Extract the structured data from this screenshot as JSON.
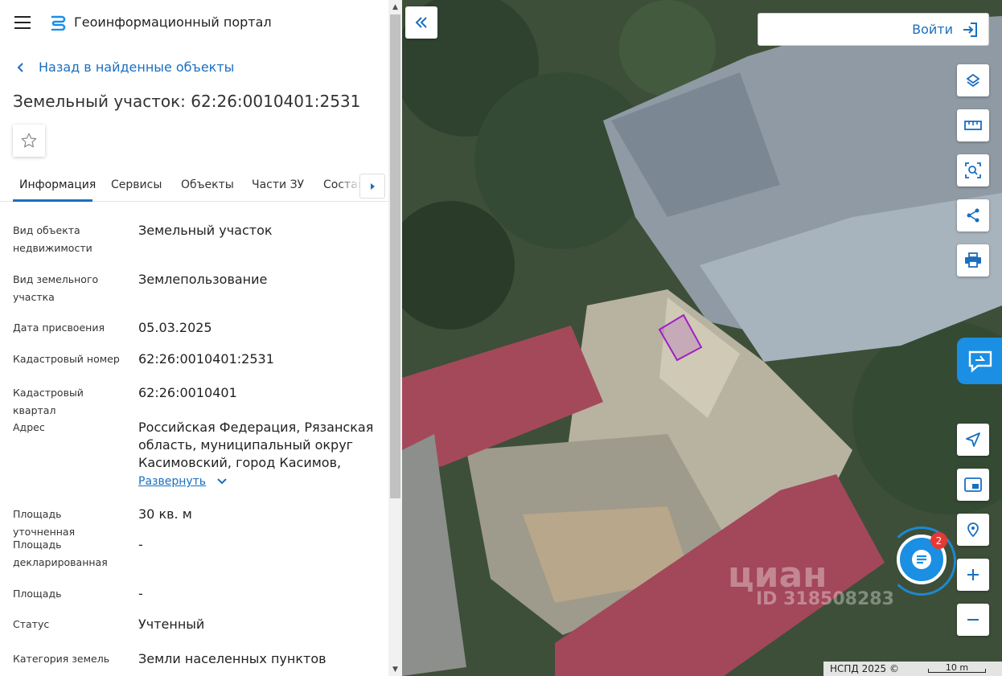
{
  "header": {
    "app_title": "Геоинформационный портал"
  },
  "nav": {
    "back_label": "Назад в найденные объекты"
  },
  "object": {
    "title": "Земельный участок: 62:26:0010401:2531"
  },
  "tabs": [
    {
      "label": "Информация",
      "active": true
    },
    {
      "label": "Сервисы",
      "active": false
    },
    {
      "label": "Объекты",
      "active": false
    },
    {
      "label": "Части ЗУ",
      "active": false
    },
    {
      "label": "Состав",
      "active": false
    }
  ],
  "info": {
    "kind_label": "Вид объекта недвижимости",
    "kind_value": "Земельный участок",
    "land_kind_label": "Вид земельного участка",
    "land_kind_value": "Землепользование",
    "date_label": "Дата присвоения",
    "date_value": "05.03.2025",
    "cad_num_label": "Кадастровый номер",
    "cad_num_value": "62:26:0010401:2531",
    "cad_quarter_label": "Кадастровый квартал",
    "cad_quarter_value": "62:26:0010401",
    "address_label": "Адрес",
    "address_value": "Российская Федерация, Рязанская область, муниципальный округ Касимовский, город Касимов, улица",
    "expand_label": "Развернуть",
    "area_refined_label": "Площадь уточненная",
    "area_refined_value": "30 кв. м",
    "area_declared_label": "Площадь декларированная",
    "area_declared_value": "-",
    "area_label": "Площадь",
    "area_value": "-",
    "status_label": "Статус",
    "status_value": "Учтенный",
    "category_label": "Категория земель",
    "category_value": "Земли населенных пунктов"
  },
  "map": {
    "login_label": "Войти",
    "badge_count": "2",
    "watermark": "циан",
    "watermark_id": "ID 318508283",
    "attribution": "НСПД 2025 ©",
    "scale_label": "10 m",
    "accent": "#1a6fc0",
    "parcel_color": "#a020c0"
  }
}
